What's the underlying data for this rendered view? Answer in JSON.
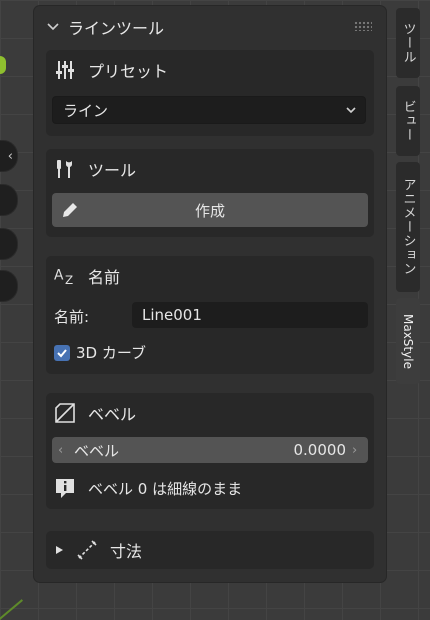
{
  "panel": {
    "title": "ラインツール"
  },
  "sections": {
    "preset": {
      "label": "プリセット",
      "icon": "sliders-icon",
      "dropdown_value": "ライン"
    },
    "tool": {
      "label": "ツール",
      "icon": "tools-icon",
      "create_button": "作成"
    },
    "name": {
      "label": "名前",
      "icon": "az-icon",
      "field_label": "名前:",
      "field_value": "Line001",
      "checkbox_label": "3D カーブ",
      "checkbox_checked": true
    },
    "bevel": {
      "label": "ベベル",
      "icon": "bevel-icon",
      "slider_label": "ベベル",
      "slider_value": "0.0000",
      "info_text": "ベベル 0 は細線のまま"
    },
    "dimension": {
      "label": "寸法",
      "icon": "measure-icon",
      "collapsed": true
    }
  },
  "side_tabs": [
    {
      "label": "ツール"
    },
    {
      "label": "ビュー"
    },
    {
      "label": "アニメーション"
    },
    {
      "label": "MaxStyle"
    }
  ],
  "colors": {
    "accent_checkbox": "#4772b3",
    "panel_bg": "#303030",
    "section_bg": "#282828",
    "button_bg": "#545454",
    "field_bg": "#1d1d1d"
  }
}
